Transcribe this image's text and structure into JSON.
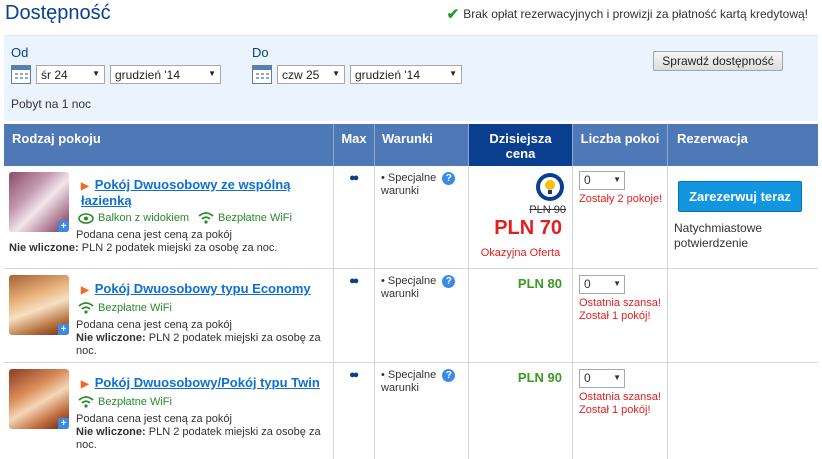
{
  "header": {
    "title": "Dostępność",
    "no_fees": "Brak opłat rezerwacyjnych i prowizji za płatność kartą kredytową!"
  },
  "search": {
    "from_label": "Od",
    "from_day": "śr 24",
    "from_month": "grudzień '14",
    "to_label": "Do",
    "to_day": "czw 25",
    "to_month": "grudzień '14",
    "check_button": "Sprawdź dostępność",
    "stay": "Pobyt na 1 noc"
  },
  "columns": {
    "room": "Rodzaj pokoju",
    "max": "Max",
    "conditions": "Warunki",
    "today_1": "Dzisiejsza",
    "today_2": "cena",
    "count": "Liczba pokoi",
    "reservation": "Rezerwacja"
  },
  "rows": [
    {
      "name_1": "Pokój Dwuosobowy ze wspólną",
      "name_2": "łazienką",
      "feature_1": "Balkon z widokiem",
      "feature_2": "Bezpłatne WiFi",
      "note_1": "Podana cena jest ceną za pokój",
      "not_incl_label": "Nie wliczone:",
      "not_incl": "PLN 2 podatek miejski za osobę za noc.",
      "cond_1": "Specjalne",
      "cond_2": "warunki",
      "old_price": "PLN 90",
      "price": "PLN 70",
      "offer": "Okazyjna Oferta",
      "qty": "0",
      "warn_1": "Zostały 2 pokoje!"
    },
    {
      "name_1": "Pokój Dwuosobowy typu Economy",
      "feature_2": "Bezpłatne WiFi",
      "note_1": "Podana cena jest ceną za pokój",
      "not_incl_label": "Nie wliczone:",
      "not_incl_a": "PLN 2 podatek miejski za osobę za",
      "not_incl_b": "noc.",
      "cond_1": "Specjalne",
      "cond_2": "warunki",
      "price": "PLN 80",
      "qty": "0",
      "warn_1": "Ostatnia szansa!",
      "warn_2": "Został 1 pokój!"
    },
    {
      "name_1": "Pokój Dwuosobowy/Pokój typu Twin",
      "feature_2": "Bezpłatne WiFi",
      "note_1": "Podana cena jest ceną za pokój",
      "not_incl_label": "Nie wliczone:",
      "not_incl_a": "PLN 2 podatek miejski za osobę za",
      "not_incl_b": "noc.",
      "cond_1": "Specjalne",
      "cond_2": "warunki",
      "price": "PLN 90",
      "qty": "0",
      "warn_1": "Ostatnia szansa!",
      "warn_2": "Został 1 pokój!"
    }
  ],
  "reservation": {
    "button": "Zarezerwuj teraz",
    "confirm_1": "Natychmiastowe",
    "confirm_2": "potwierdzenie"
  }
}
